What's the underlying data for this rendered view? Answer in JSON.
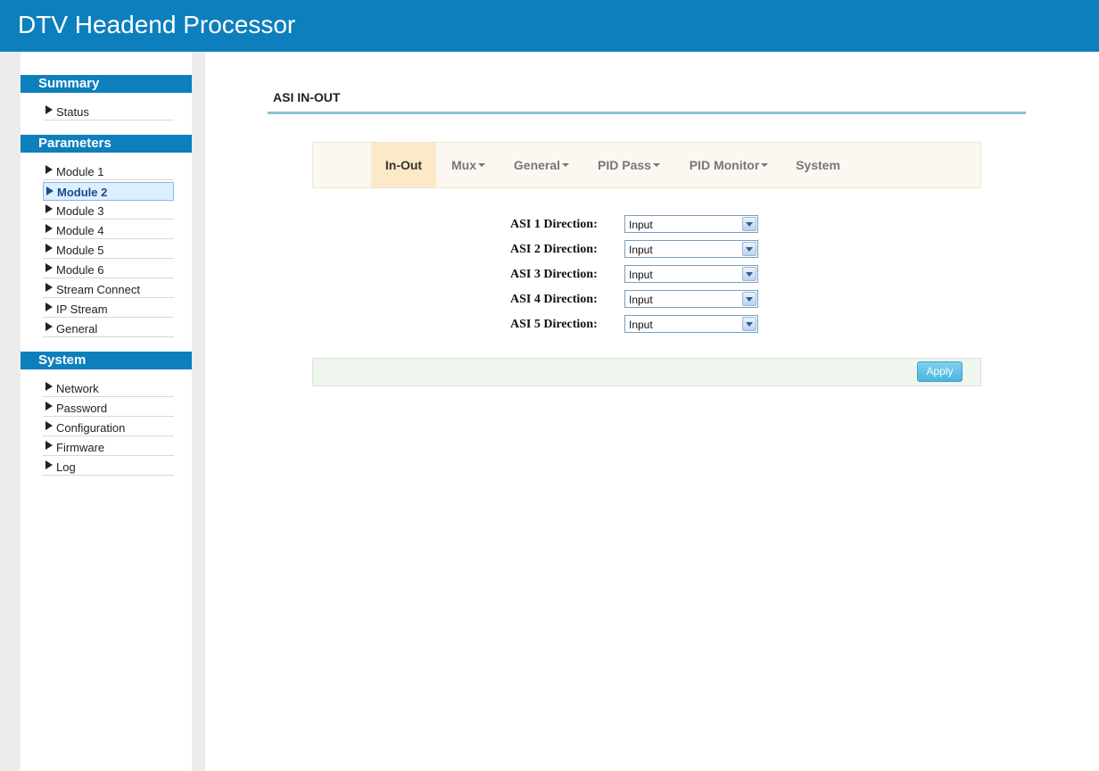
{
  "header": {
    "title": "DTV Headend Processor"
  },
  "sidebar": {
    "sections": [
      {
        "title": "Summary",
        "items": [
          "Status"
        ]
      },
      {
        "title": "Parameters",
        "items": [
          "Module 1",
          "Module 2",
          "Module 3",
          "Module 4",
          "Module 5",
          "Module 6",
          "Stream Connect",
          "IP Stream",
          "General"
        ]
      },
      {
        "title": "System",
        "items": [
          "Network",
          "Password",
          "Configuration",
          "Firmware",
          "Log"
        ]
      }
    ],
    "active_item": "Module 2"
  },
  "main": {
    "page_title": "ASI IN-OUT",
    "tabs": [
      {
        "label": "In-Out",
        "dropdown": false,
        "active": true
      },
      {
        "label": "Mux",
        "dropdown": true,
        "active": false
      },
      {
        "label": "General",
        "dropdown": true,
        "active": false
      },
      {
        "label": "PID Pass",
        "dropdown": true,
        "active": false
      },
      {
        "label": "PID Monitor",
        "dropdown": true,
        "active": false
      },
      {
        "label": "System",
        "dropdown": false,
        "active": false
      }
    ],
    "fields": [
      {
        "label": "ASI 1 Direction:",
        "value": "Input"
      },
      {
        "label": "ASI 2 Direction:",
        "value": "Input"
      },
      {
        "label": "ASI 3 Direction:",
        "value": "Input"
      },
      {
        "label": "ASI 4 Direction:",
        "value": "Input"
      },
      {
        "label": "ASI 5 Direction:",
        "value": "Input"
      }
    ],
    "apply_label": "Apply"
  },
  "colors": {
    "header": "#0e7fbd",
    "active_tab": "#fbe9c8",
    "apply": "#49b4dd"
  }
}
